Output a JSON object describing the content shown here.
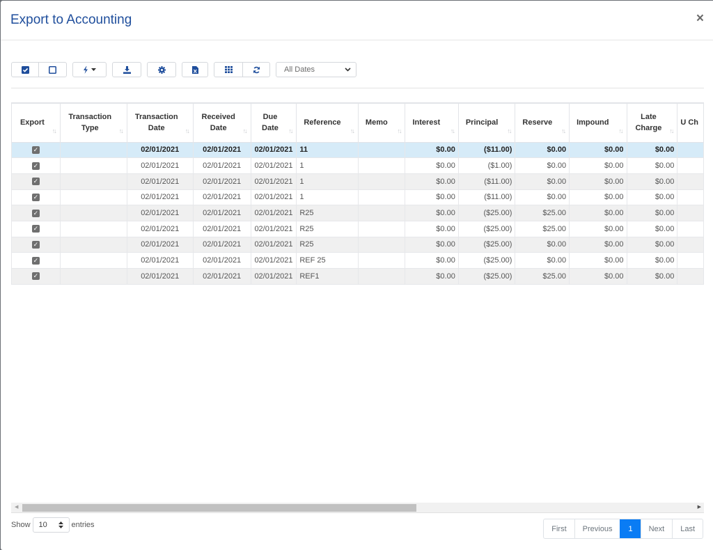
{
  "modal": {
    "title": "Export to Accounting",
    "close_label": "×"
  },
  "toolbar": {
    "select_all_icon": "check-square-icon",
    "deselect_all_icon": "square-icon",
    "actions_icon": "bolt-icon",
    "download_icon": "download-icon",
    "settings_icon": "gear-icon",
    "excel_icon": "file-excel-icon",
    "columns_icon": "grid-icon",
    "refresh_icon": "refresh-icon",
    "date_filter": {
      "selected": "All Dates"
    }
  },
  "table": {
    "columns": [
      {
        "label": "Export"
      },
      {
        "label": "Transaction Type"
      },
      {
        "label": "Transaction Date"
      },
      {
        "label": "Received Date"
      },
      {
        "label": "Due Date"
      },
      {
        "label": "Reference"
      },
      {
        "label": "Memo"
      },
      {
        "label": "Interest"
      },
      {
        "label": "Principal"
      },
      {
        "label": "Reserve"
      },
      {
        "label": "Impound"
      },
      {
        "label": "Late Charge"
      },
      {
        "label": "U Ch"
      }
    ],
    "rows": [
      {
        "export": true,
        "type": "",
        "txn_date": "02/01/2021",
        "recv_date": "02/01/2021",
        "due_date": "02/01/2021",
        "reference": "11",
        "memo": "",
        "interest": "$0.00",
        "principal": "($11.00)",
        "reserve": "$0.00",
        "impound": "$0.00",
        "late_charge": "$0.00",
        "selected": true
      },
      {
        "export": true,
        "type": "",
        "txn_date": "02/01/2021",
        "recv_date": "02/01/2021",
        "due_date": "02/01/2021",
        "reference": "1",
        "memo": "",
        "interest": "$0.00",
        "principal": "($1.00)",
        "reserve": "$0.00",
        "impound": "$0.00",
        "late_charge": "$0.00"
      },
      {
        "export": true,
        "type": "",
        "txn_date": "02/01/2021",
        "recv_date": "02/01/2021",
        "due_date": "02/01/2021",
        "reference": "1",
        "memo": "",
        "interest": "$0.00",
        "principal": "($11.00)",
        "reserve": "$0.00",
        "impound": "$0.00",
        "late_charge": "$0.00"
      },
      {
        "export": true,
        "type": "",
        "txn_date": "02/01/2021",
        "recv_date": "02/01/2021",
        "due_date": "02/01/2021",
        "reference": "1",
        "memo": "",
        "interest": "$0.00",
        "principal": "($11.00)",
        "reserve": "$0.00",
        "impound": "$0.00",
        "late_charge": "$0.00"
      },
      {
        "export": true,
        "type": "",
        "txn_date": "02/01/2021",
        "recv_date": "02/01/2021",
        "due_date": "02/01/2021",
        "reference": "R25",
        "memo": "",
        "interest": "$0.00",
        "principal": "($25.00)",
        "reserve": "$25.00",
        "impound": "$0.00",
        "late_charge": "$0.00"
      },
      {
        "export": true,
        "type": "",
        "txn_date": "02/01/2021",
        "recv_date": "02/01/2021",
        "due_date": "02/01/2021",
        "reference": "R25",
        "memo": "",
        "interest": "$0.00",
        "principal": "($25.00)",
        "reserve": "$25.00",
        "impound": "$0.00",
        "late_charge": "$0.00"
      },
      {
        "export": true,
        "type": "",
        "txn_date": "02/01/2021",
        "recv_date": "02/01/2021",
        "due_date": "02/01/2021",
        "reference": "R25",
        "memo": "",
        "interest": "$0.00",
        "principal": "($25.00)",
        "reserve": "$0.00",
        "impound": "$0.00",
        "late_charge": "$0.00"
      },
      {
        "export": true,
        "type": "",
        "txn_date": "02/01/2021",
        "recv_date": "02/01/2021",
        "due_date": "02/01/2021",
        "reference": "REF 25",
        "memo": "",
        "interest": "$0.00",
        "principal": "($25.00)",
        "reserve": "$0.00",
        "impound": "$0.00",
        "late_charge": "$0.00"
      },
      {
        "export": true,
        "type": "",
        "txn_date": "02/01/2021",
        "recv_date": "02/01/2021",
        "due_date": "02/01/2021",
        "reference": "REF1",
        "memo": "",
        "interest": "$0.00",
        "principal": "($25.00)",
        "reserve": "$25.00",
        "impound": "$0.00",
        "late_charge": "$0.00"
      }
    ]
  },
  "footer": {
    "show_label": "Show",
    "page_length": "10",
    "entries_label": "entries",
    "pagination": {
      "first": "First",
      "previous": "Previous",
      "current": "1",
      "next": "Next",
      "last": "Last"
    }
  }
}
